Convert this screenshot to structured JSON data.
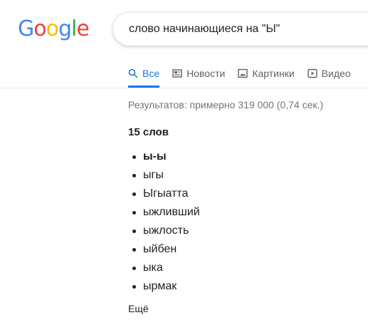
{
  "logo": {
    "letters": [
      {
        "char": "G",
        "color": "#4285F4"
      },
      {
        "char": "o",
        "color": "#EA4335"
      },
      {
        "char": "o",
        "color": "#FBBC05"
      },
      {
        "char": "g",
        "color": "#4285F4"
      },
      {
        "char": "l",
        "color": "#34A853"
      },
      {
        "char": "e",
        "color": "#EA4335"
      }
    ]
  },
  "search": {
    "query": "слово начинающиеся на \"Ы\""
  },
  "tabs": [
    {
      "label": "Все",
      "icon": "search-icon",
      "active": true
    },
    {
      "label": "Новости",
      "icon": "news-icon",
      "active": false
    },
    {
      "label": "Картинки",
      "icon": "images-icon",
      "active": false
    },
    {
      "label": "Видео",
      "icon": "video-icon",
      "active": false
    }
  ],
  "results": {
    "stats": "Результатов: примерно 319 000 (0,74 сек.)",
    "heading": "15 слов",
    "words": [
      "ы-ы",
      "ыгы",
      "Ыгыатта",
      "ыжливший",
      "ыжлость",
      "ыйбен",
      "ыка",
      "ырмак"
    ],
    "more_label": "Ещё"
  },
  "colors": {
    "accent": "#1a73e8",
    "muted": "#70757a"
  }
}
